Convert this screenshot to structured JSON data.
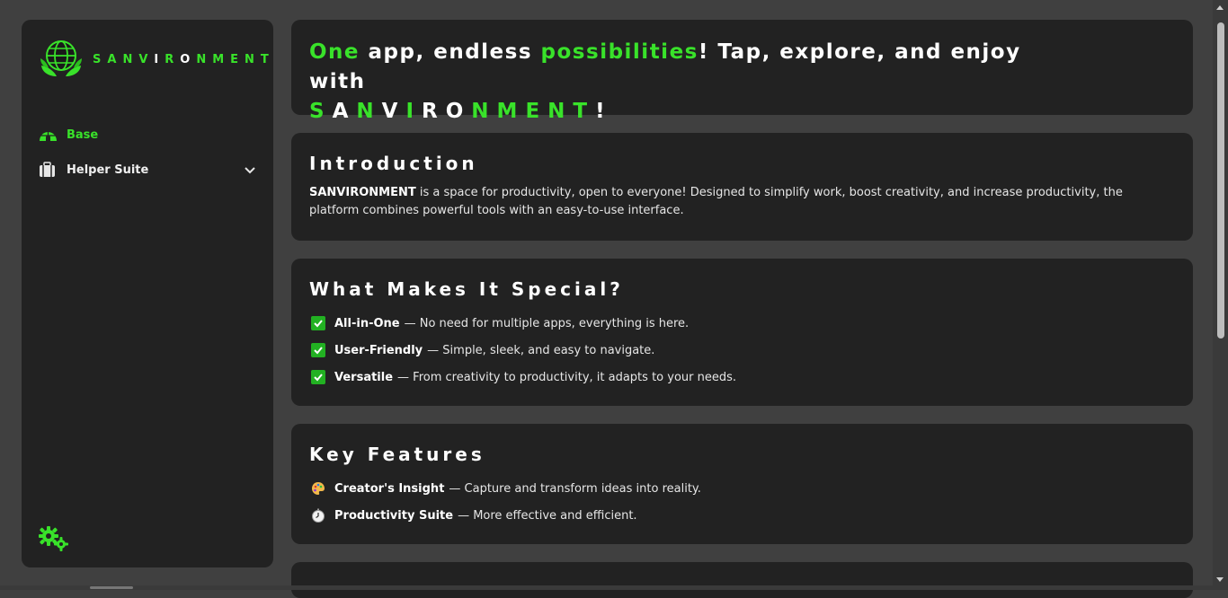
{
  "app": {
    "brand_letters": [
      {
        "ch": "S",
        "c": "g"
      },
      {
        "ch": "A",
        "c": "g"
      },
      {
        "ch": "N",
        "c": "g"
      },
      {
        "ch": "V",
        "c": "g"
      },
      {
        "ch": "I",
        "c": "w"
      },
      {
        "ch": "R",
        "c": "g"
      },
      {
        "ch": "O",
        "c": "w"
      },
      {
        "ch": "N",
        "c": "g"
      },
      {
        "ch": "M",
        "c": "g"
      },
      {
        "ch": "E",
        "c": "g"
      },
      {
        "ch": "N",
        "c": "g"
      },
      {
        "ch": "T",
        "c": "g"
      }
    ],
    "accent_color": "#39e22a"
  },
  "sidebar": {
    "items": [
      {
        "label": "Base",
        "icon": "igloo-icon",
        "active": true
      },
      {
        "label": "Helper Suite",
        "icon": "briefcase-icon",
        "active": false,
        "expandable": true
      }
    ],
    "settings_icon": "gears-icon"
  },
  "hero": {
    "w1": "One",
    "t1": " app, endless ",
    "w2": "possibilities",
    "t2": "! Tap, explore, and enjoy with",
    "brand_letters": [
      {
        "ch": "S",
        "c": "g"
      },
      {
        "ch": "A",
        "c": "w"
      },
      {
        "ch": "N",
        "c": "g"
      },
      {
        "ch": "V",
        "c": "w"
      },
      {
        "ch": "I",
        "c": "g"
      },
      {
        "ch": "R",
        "c": "w"
      },
      {
        "ch": "O",
        "c": "w"
      },
      {
        "ch": "N",
        "c": "g"
      },
      {
        "ch": "M",
        "c": "g"
      },
      {
        "ch": "E",
        "c": "g"
      },
      {
        "ch": "N",
        "c": "g"
      },
      {
        "ch": "T",
        "c": "g"
      }
    ],
    "end": "!"
  },
  "intro": {
    "title": "Introduction",
    "brand": "SANVIRONMENT",
    "body": " is a space for productivity, open to everyone! Designed to simplify work, boost creativity, and increase productivity, the platform combines powerful tools with an easy-to-use interface."
  },
  "special": {
    "title": "What Makes It Special?",
    "items": [
      {
        "name": "All-in-One",
        "desc": "— No need for multiple apps, everything is here."
      },
      {
        "name": "User-Friendly",
        "desc": "— Simple, sleek, and easy to navigate."
      },
      {
        "name": "Versatile",
        "desc": "— From creativity to productivity, it adapts to your needs."
      }
    ]
  },
  "features": {
    "title": "Key Features",
    "items": [
      {
        "icon": "palette-icon",
        "name": "Creator's Insight",
        "desc": "— Capture and transform ideas into reality."
      },
      {
        "icon": "stopwatch-icon",
        "name": "Productivity Suite",
        "desc": "— More effective and efficient."
      }
    ]
  }
}
